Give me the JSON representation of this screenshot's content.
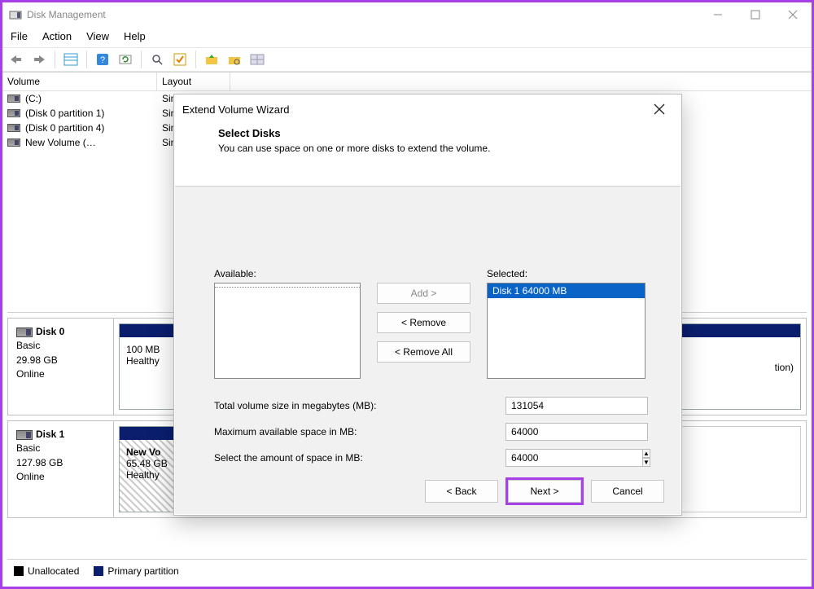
{
  "window": {
    "title": "Disk Management"
  },
  "menu": {
    "file": "File",
    "action": "Action",
    "view": "View",
    "help": "Help"
  },
  "columns": {
    "volume": "Volume",
    "layout": "Layout"
  },
  "volumes": [
    {
      "name": "(C:)",
      "layout": "Simpl"
    },
    {
      "name": "(Disk 0 partition 1)",
      "layout": "Simpl"
    },
    {
      "name": "(Disk 0 partition 4)",
      "layout": "Simpl"
    },
    {
      "name": "New Volume (…",
      "layout": "Simpl"
    }
  ],
  "disks": [
    {
      "name": "Disk 0",
      "type": "Basic",
      "size": "29.98 GB",
      "status": "Online",
      "part": {
        "title": "",
        "line1": "100 MB",
        "line2": "Healthy",
        "tail": "tion)"
      }
    },
    {
      "name": "Disk 1",
      "type": "Basic",
      "size": "127.98 GB",
      "status": "Online",
      "part": {
        "title": "New Vo",
        "line1": "65.48 GB",
        "line2": "Healthy"
      }
    }
  ],
  "legend": {
    "unalloc": "Unallocated",
    "primary": "Primary partition"
  },
  "dialog": {
    "title": "Extend Volume Wizard",
    "heading": "Select Disks",
    "sub": "You can use space on one or more disks to extend the volume.",
    "available_label": "Available:",
    "selected_label": "Selected:",
    "selected_item": "Disk 1      64000 MB",
    "add": "Add >",
    "remove": "< Remove",
    "remove_all": "< Remove All",
    "total_label": "Total volume size in megabytes (MB):",
    "total_value": "131054",
    "max_label": "Maximum available space in MB:",
    "max_value": "64000",
    "amount_label": "Select the amount of space in MB:",
    "amount_value": "64000",
    "back": "< Back",
    "next": "Next >",
    "cancel": "Cancel"
  }
}
